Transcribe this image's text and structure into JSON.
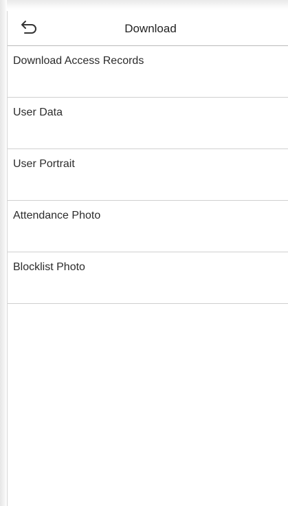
{
  "header": {
    "title": "Download",
    "back_icon": "back-arrow-icon"
  },
  "menu": {
    "items": [
      {
        "label": "Download Access Records"
      },
      {
        "label": "User Data"
      },
      {
        "label": "User Portrait"
      },
      {
        "label": "Attendance Photo"
      },
      {
        "label": "Blocklist Photo"
      }
    ]
  }
}
